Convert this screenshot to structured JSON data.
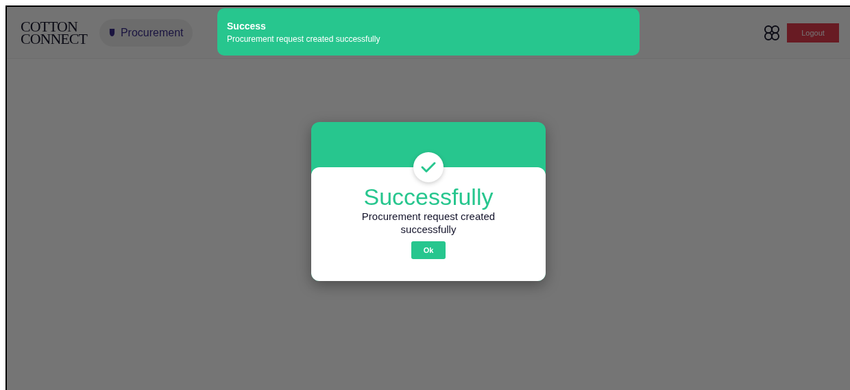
{
  "header": {
    "logo": [
      "COTTON",
      "CONNECT"
    ],
    "nav": [
      {
        "label": "Procurement"
      }
    ],
    "logout": "Logout"
  },
  "toast": {
    "title": "Success",
    "message": "Procurement request created successfully"
  },
  "dialog": {
    "title": "Successfully",
    "message": "Procurement request created successfully",
    "button": "Ok"
  }
}
